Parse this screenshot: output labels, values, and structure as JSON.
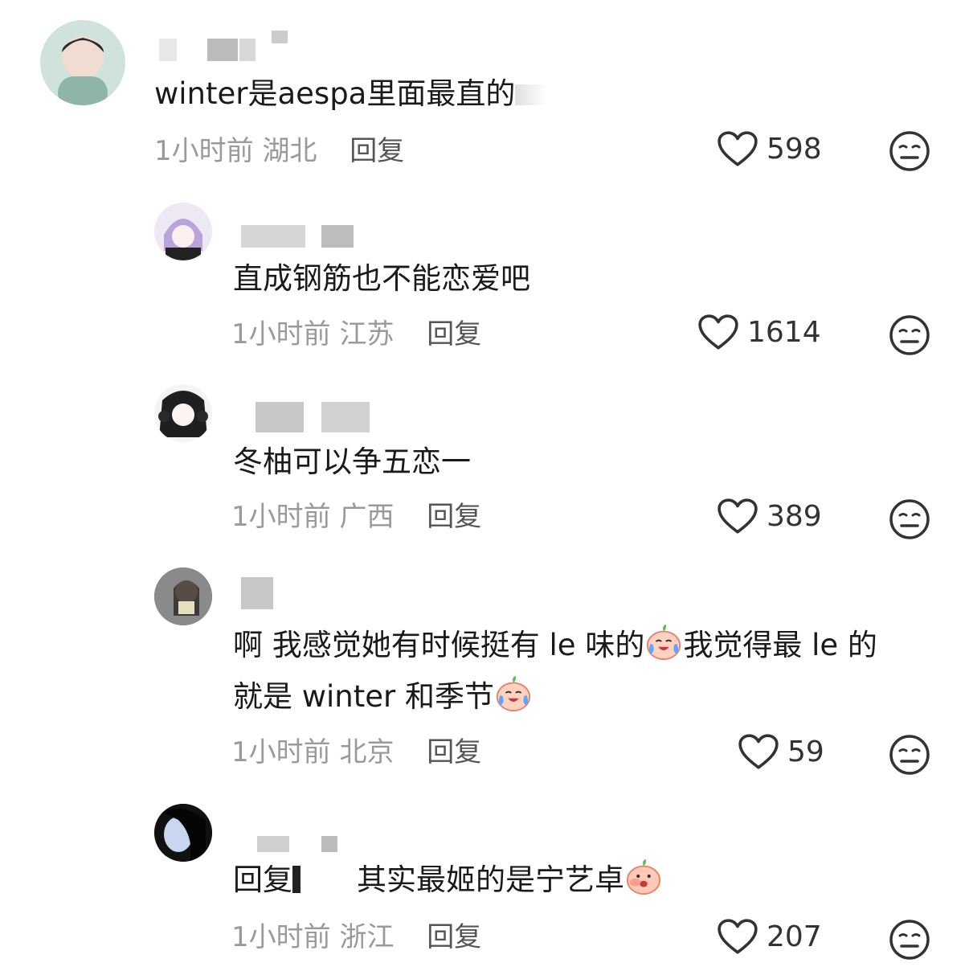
{
  "comments": [
    {
      "text": "winter是aespa里面最直的",
      "time": "1小时前",
      "location": "湖北",
      "reply": "回复",
      "likes": "598"
    },
    {
      "text": "直成钢筋也不能恋爱吧",
      "time": "1小时前",
      "location": "江苏",
      "reply": "回复",
      "likes": "1614"
    },
    {
      "text": "冬柚可以争五恋一",
      "time": "1小时前",
      "location": "广西",
      "reply": "回复",
      "likes": "389"
    },
    {
      "line1a": "啊 我感觉她有时候挺有 le 味的",
      "line1b": "我觉得最 le 的",
      "line2": "就是 winter 和季节",
      "time": "1小时前",
      "location": "北京",
      "reply": "回复",
      "likes": "59"
    },
    {
      "prefix": "回复",
      "text": "其实最姬的是宁艺卓",
      "time": "1小时前",
      "location": "浙江",
      "reply": "回复",
      "likes": "207"
    }
  ],
  "icons": {
    "like": "heart-outline-icon",
    "dislike": "meh-face-icon",
    "emoji": "crying-laugh-emoji"
  },
  "colors": {
    "text": "#1a1a1a",
    "meta": "#9a9a9a",
    "reply": "#555555"
  }
}
